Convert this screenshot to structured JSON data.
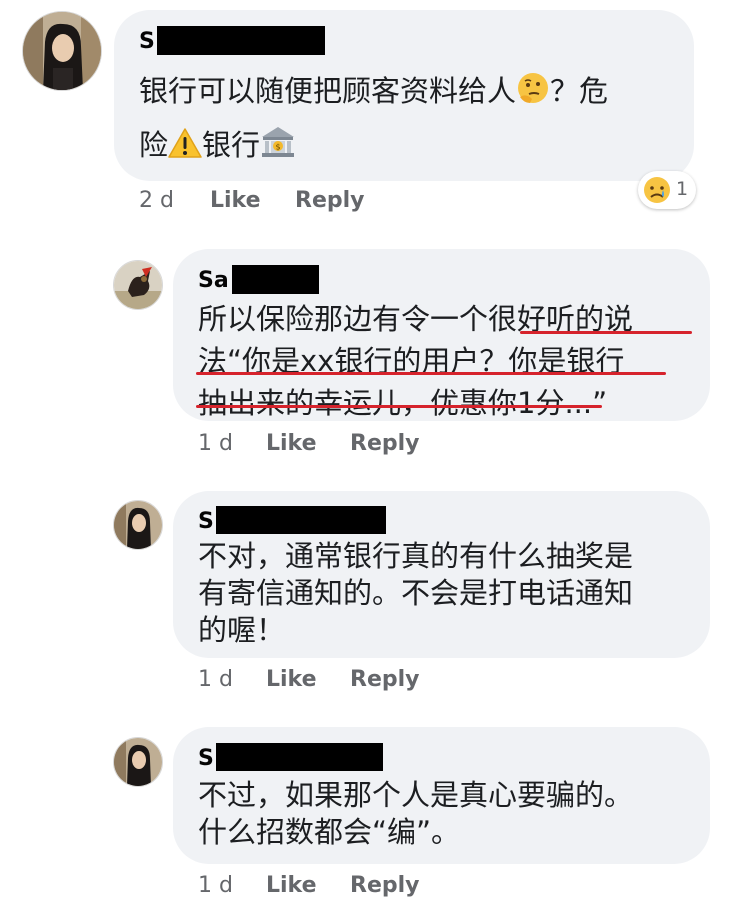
{
  "comments": [
    {
      "name_visible": "S",
      "text_line1": "银行可以随便把顾客资料给人",
      "text_line1_tail": "？危",
      "text_line2a": "险",
      "text_line2b": "银行",
      "time": "2 d",
      "like_label": "Like",
      "reply_label": "Reply",
      "reaction_count": "1",
      "emoji": [
        "thinking-face-icon",
        "warning-icon",
        "bank-icon"
      ],
      "reaction": "sad-face-icon"
    },
    {
      "name_visible": "Sa",
      "text_line1": "所以保险那边有令一个很好听的说",
      "text_line2": "法“你是xx银行的用户？你是银行",
      "text_line3": "抽出来的幸运儿，优惠你1分...”",
      "time": "1 d",
      "like_label": "Like",
      "reply_label": "Reply"
    },
    {
      "name_visible": "S",
      "text_line1": "不对，通常银行真的有什么抽奖是",
      "text_line2": "有寄信通知的。不会是打电话通知",
      "text_line3": "的喔！",
      "time": "1 d",
      "like_label": "Like",
      "reply_label": "Reply"
    },
    {
      "name_visible": "S",
      "text_line1": "不过，如果那个人是真心要骗的。",
      "text_line2": "什么招数都会“编”。",
      "time": "1 d",
      "like_label": "Like",
      "reply_label": "Reply"
    }
  ],
  "colors": {
    "bubble": "#f0f2f5",
    "underline": "#d6232c",
    "meta": "#65676b"
  }
}
